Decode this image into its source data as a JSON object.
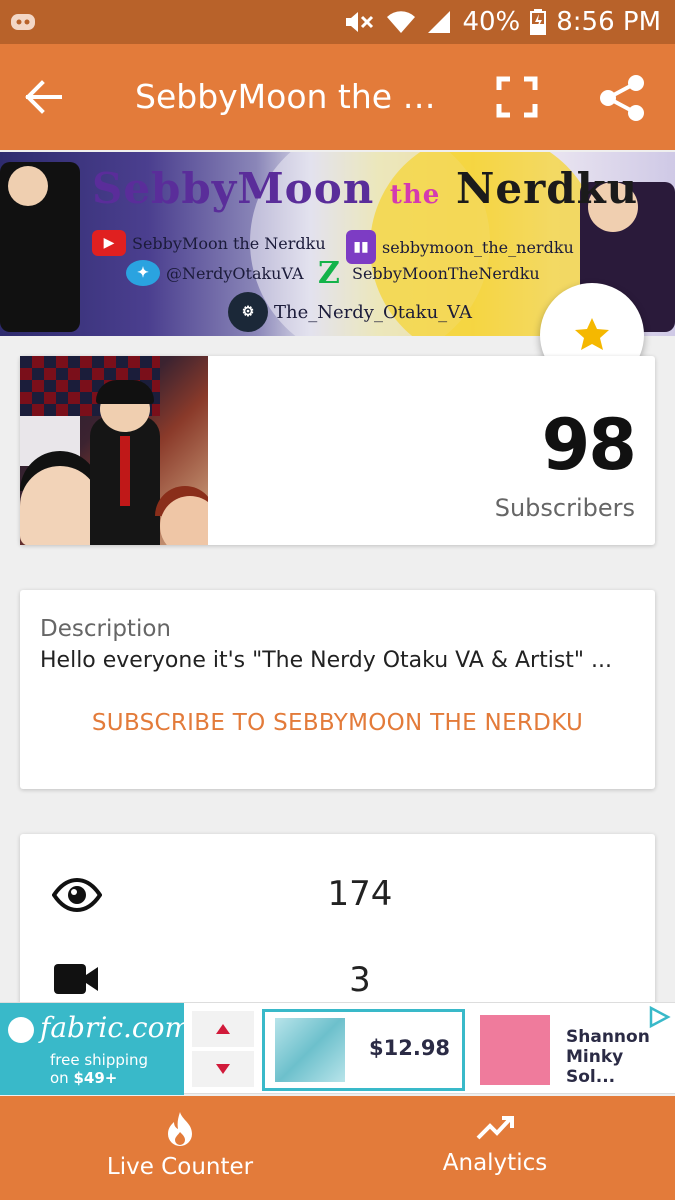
{
  "status_bar": {
    "battery": "40%",
    "time": "8:56 PM",
    "icons": [
      "discord-icon",
      "mute-icon",
      "wifi-icon",
      "signal-icon",
      "battery-icon"
    ]
  },
  "app_bar": {
    "title": "SebbyMoon the N...",
    "icons": [
      "back-arrow-icon",
      "fullscreen-icon",
      "share-icon"
    ]
  },
  "banner": {
    "heading_part1": "SebbyMoon",
    "heading_part2": "the",
    "heading_part3": "Nerdku",
    "youtube": "SebbyMoon the Nerdku",
    "twitch": "sebbymoon_the_nerdku",
    "twitter": "@NerdyOtakuVA",
    "deviantart": "SebbyMoonTheNerdku",
    "steam": "The_Nerdy_Otaku_VA"
  },
  "favorite": {
    "icon": "star-icon",
    "color": "#f5b800"
  },
  "subscriber_card": {
    "count": "98",
    "label": "Subscribers"
  },
  "description_card": {
    "label": "Description",
    "text": "Hello everyone it's \"The Nerdy Otaku VA & Artist\" ...",
    "subscribe_link": "SUBSCRIBE TO SEBBYMOON THE NERDKU"
  },
  "stats_card": {
    "views": "174",
    "videos": "3",
    "icons": [
      "eye-icon",
      "video-camera-icon"
    ]
  },
  "ad": {
    "brand": "fabric.com",
    "shipping_line1": "free shipping",
    "shipping_line2_prefix": "on",
    "shipping_line2_amount": "$49+",
    "product1_price": "$12.98",
    "product2_name": "Shannon Minky Sol..."
  },
  "bottom_nav": {
    "items": [
      {
        "label": "Live Counter",
        "icon": "flame-icon"
      },
      {
        "label": "Analytics",
        "icon": "trend-up-icon"
      }
    ]
  },
  "colors": {
    "accent": "#e37b3a",
    "status_bar": "#b8622a",
    "ad_teal": "#39b9c9"
  }
}
